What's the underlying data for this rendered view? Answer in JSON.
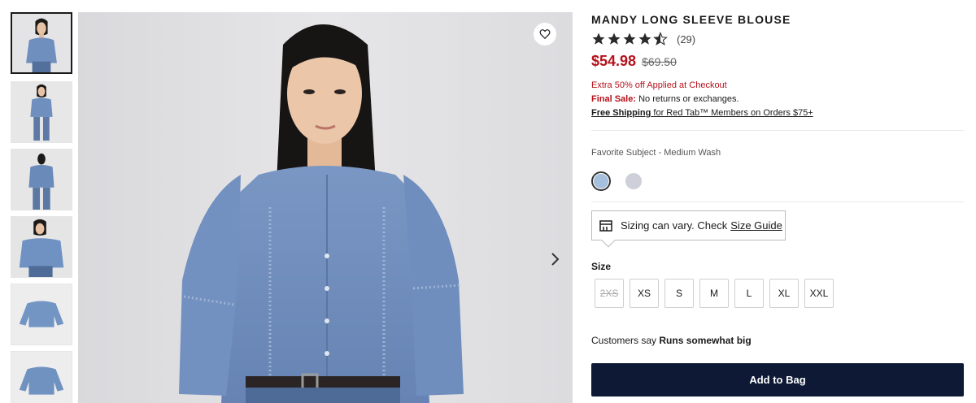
{
  "product": {
    "title": "MANDY LONG SLEEVE BLOUSE",
    "rating_value": 4.5,
    "rating_count": "(29)",
    "price_sale": "$54.98",
    "price_original": "$69.50",
    "promo": "Extra 50% off Applied at Checkout",
    "final_sale_label": "Final Sale:",
    "final_sale_text": "No returns or exchanges.",
    "shipping_bold": "Free Shipping",
    "shipping_text": "for Red Tab™ Members on Orders $75+",
    "color_label": "Favorite Subject - Medium Wash"
  },
  "colors": {
    "accent_red": "#b5121b",
    "button_navy": "#0e1a35",
    "swatch_selected": "#a6bfdc",
    "swatch_other": "#cdd0d8"
  },
  "size_guide": {
    "text": "Sizing can vary. Check",
    "link": "Size Guide"
  },
  "sizes": {
    "label": "Size",
    "options": [
      "2XS",
      "XS",
      "S",
      "M",
      "L",
      "XL",
      "XXL"
    ]
  },
  "fit": {
    "prefix": "Customers say",
    "value": "Runs somewhat big"
  },
  "actions": {
    "add_to_bag": "Add to Bag"
  },
  "gallery": {
    "thumbnail_count": 6,
    "active_index": 0
  }
}
